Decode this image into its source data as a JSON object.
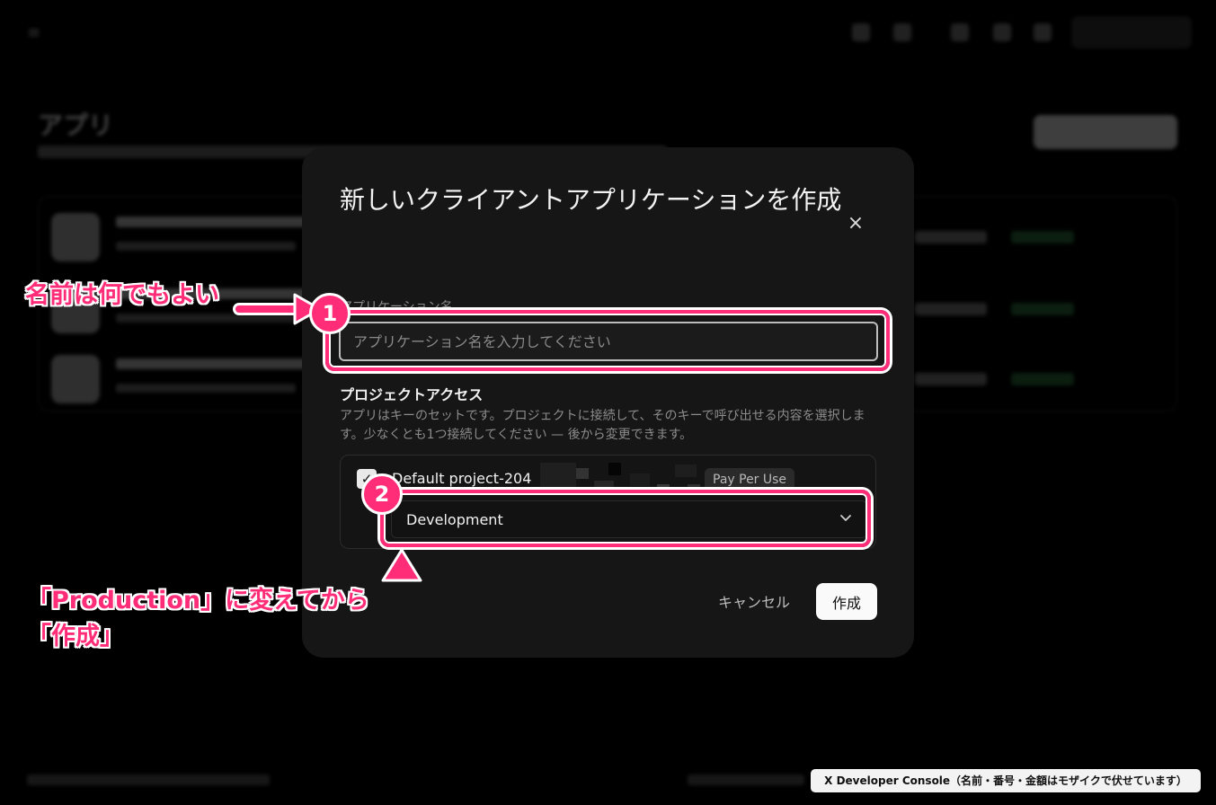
{
  "modal": {
    "title": "新しいクライアントアプリケーションを作成",
    "close_label": "×",
    "app_name_label": "アプリケーション名",
    "app_name_placeholder": "アプリケーション名を入力してください",
    "project_access_title": "プロジェクトアクセス",
    "project_access_description": "アプリはキーのセットです。プロジェクトに接続して、そのキーで呼び出せる内容を選択します。少なくとも1つ接続してください — 後から変更できます。",
    "project": {
      "name": "Default project-204",
      "checked": true,
      "checkbox_mark": "✓",
      "badge": "Pay Per Use",
      "environment": "Development"
    },
    "cancel_label": "キャンセル",
    "create_label": "作成"
  },
  "annotations": {
    "step1_number": "1",
    "step1_note": "名前は何でもよい",
    "step2_number": "2",
    "step2_note_line1": "「Production」に変えてから",
    "step2_note_line2": "「作成」",
    "accent_color": "#ff2d78"
  },
  "caption": "X Developer Console（名前・番号・金額はモザイクで伏せています）",
  "background": {
    "menu_icon": "≡",
    "page_title": "アプリ"
  },
  "icons": {
    "close": "close-icon",
    "check": "check-icon",
    "chevron": "chevron-down-icon"
  }
}
